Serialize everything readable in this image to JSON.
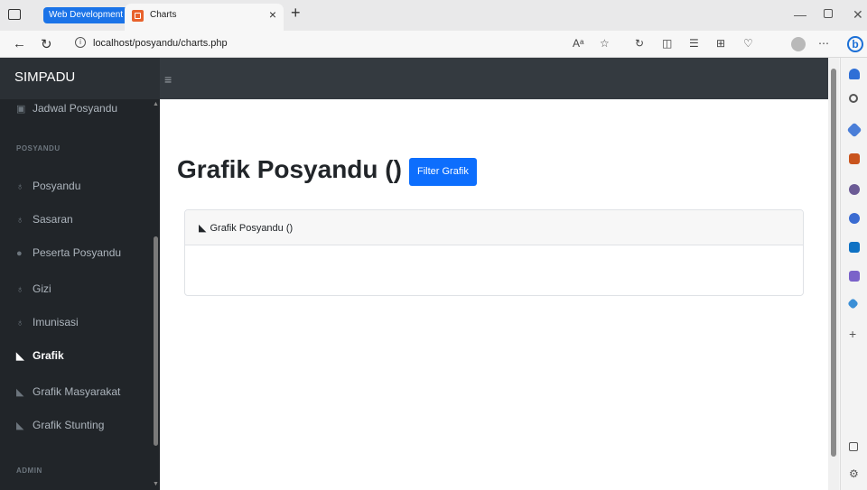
{
  "browser": {
    "tab_group": "Web Development",
    "tab_title": "Charts",
    "url": "localhost/posyandu/charts.php"
  },
  "app": {
    "brand": "SIMPADU"
  },
  "sidebar": {
    "items": [
      {
        "type": "link",
        "label": "Jadwal Posyandu",
        "icon": "calendar-icon"
      },
      {
        "type": "heading",
        "label": "POSYANDU"
      },
      {
        "type": "link",
        "label": "Posyandu",
        "icon": "stethoscope-icon"
      },
      {
        "type": "link",
        "label": "Sasaran",
        "icon": "stethoscope-icon"
      },
      {
        "type": "link",
        "label": "Peserta Posyandu",
        "icon": "user-icon"
      },
      {
        "type": "link",
        "label": "Gizi",
        "icon": "stethoscope-icon"
      },
      {
        "type": "link",
        "label": "Imunisasi",
        "icon": "stethoscope-icon"
      },
      {
        "type": "link",
        "label": "Grafik",
        "icon": "area-chart-icon",
        "active": true
      },
      {
        "type": "link",
        "label": "Grafik Masyarakat",
        "icon": "area-chart-icon"
      },
      {
        "type": "link",
        "label": "Grafik Stunting",
        "icon": "area-chart-icon"
      },
      {
        "type": "heading",
        "label": "ADMIN"
      }
    ]
  },
  "main": {
    "title": "Grafik Posyandu ()",
    "filter_button": "Filter Grafik",
    "card_title": "Grafik Posyandu ()"
  },
  "colors": {
    "primary": "#0d6efd",
    "sidebar_bg": "#212529",
    "navbar_bg": "#343a40"
  }
}
